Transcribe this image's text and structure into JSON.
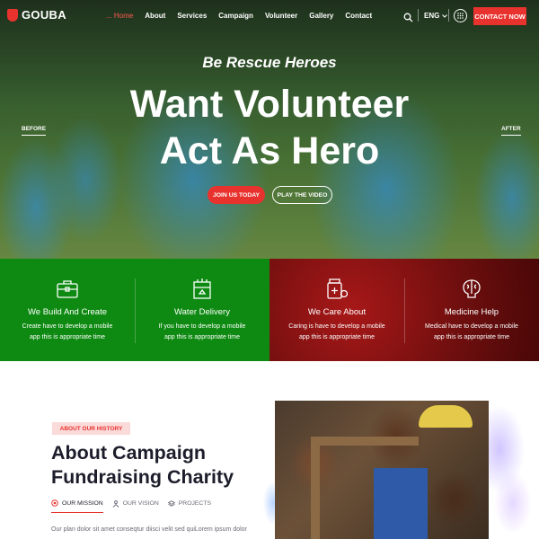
{
  "header": {
    "logo_text": "GOUBA",
    "nav": [
      "Home",
      "About",
      "Services",
      "Campaign",
      "Volunteer",
      "Gallery",
      "Contact"
    ],
    "active_nav": "Home",
    "language": "ENG",
    "contact_label": "CONTACT NOW"
  },
  "hero": {
    "tagline": "Be Rescue Heroes",
    "headline_line1": "Want Volunteer",
    "headline_line2": "Act As Hero",
    "before_label": "BEFORE",
    "after_label": "AFTER",
    "join_label": "JOIN US TODAY",
    "play_label": "PLAY THE VIDEO"
  },
  "features": [
    {
      "title": "We Build And Create",
      "desc1": "Create have to develop a mobile",
      "desc2": "app this is appropriate time",
      "icon": "toolbox-icon"
    },
    {
      "title": "Water Delivery",
      "desc1": "If you have to develop a mobile",
      "desc2": "app this is appropriate time",
      "icon": "water-delivery-icon"
    },
    {
      "title": "We Care About",
      "desc1": "Caring is have to develop a mobile",
      "desc2": "app this is appropriate time",
      "icon": "medicine-bottle-icon"
    },
    {
      "title": "Medicine Help",
      "desc1": "Medical have to develop a mobile",
      "desc2": "app this is appropriate time",
      "icon": "brain-icon"
    }
  ],
  "about": {
    "badge": "ABOUT OUR HISTORY",
    "title_line1": "About Campaign",
    "title_line2": "Fundraising Charity",
    "tabs": [
      "OUR MISSION",
      "OUR VISION",
      "PROJECTS"
    ],
    "active_tab": "OUR MISSION",
    "text": "Our plan dolor sit amet conseqtur diisci velit sed quiLorem ipsum dolor"
  },
  "colors": {
    "accent": "#e8322e",
    "green": "#0e8a12",
    "dark_red": "#6c0e0e",
    "heading": "#1d1d2b"
  }
}
